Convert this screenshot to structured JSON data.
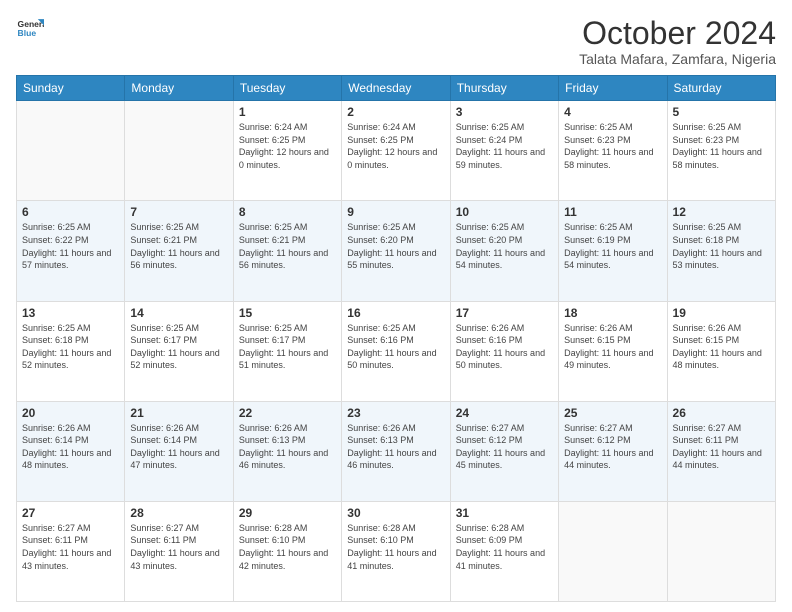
{
  "header": {
    "logo_line1": "General",
    "logo_line2": "Blue",
    "month": "October 2024",
    "location": "Talata Mafara, Zamfara, Nigeria"
  },
  "weekdays": [
    "Sunday",
    "Monday",
    "Tuesday",
    "Wednesday",
    "Thursday",
    "Friday",
    "Saturday"
  ],
  "weeks": [
    [
      {
        "day": "",
        "sunrise": "",
        "sunset": "",
        "daylight": ""
      },
      {
        "day": "",
        "sunrise": "",
        "sunset": "",
        "daylight": ""
      },
      {
        "day": "1",
        "sunrise": "Sunrise: 6:24 AM",
        "sunset": "Sunset: 6:25 PM",
        "daylight": "Daylight: 12 hours and 0 minutes."
      },
      {
        "day": "2",
        "sunrise": "Sunrise: 6:24 AM",
        "sunset": "Sunset: 6:25 PM",
        "daylight": "Daylight: 12 hours and 0 minutes."
      },
      {
        "day": "3",
        "sunrise": "Sunrise: 6:25 AM",
        "sunset": "Sunset: 6:24 PM",
        "daylight": "Daylight: 11 hours and 59 minutes."
      },
      {
        "day": "4",
        "sunrise": "Sunrise: 6:25 AM",
        "sunset": "Sunset: 6:23 PM",
        "daylight": "Daylight: 11 hours and 58 minutes."
      },
      {
        "day": "5",
        "sunrise": "Sunrise: 6:25 AM",
        "sunset": "Sunset: 6:23 PM",
        "daylight": "Daylight: 11 hours and 58 minutes."
      }
    ],
    [
      {
        "day": "6",
        "sunrise": "Sunrise: 6:25 AM",
        "sunset": "Sunset: 6:22 PM",
        "daylight": "Daylight: 11 hours and 57 minutes."
      },
      {
        "day": "7",
        "sunrise": "Sunrise: 6:25 AM",
        "sunset": "Sunset: 6:21 PM",
        "daylight": "Daylight: 11 hours and 56 minutes."
      },
      {
        "day": "8",
        "sunrise": "Sunrise: 6:25 AM",
        "sunset": "Sunset: 6:21 PM",
        "daylight": "Daylight: 11 hours and 56 minutes."
      },
      {
        "day": "9",
        "sunrise": "Sunrise: 6:25 AM",
        "sunset": "Sunset: 6:20 PM",
        "daylight": "Daylight: 11 hours and 55 minutes."
      },
      {
        "day": "10",
        "sunrise": "Sunrise: 6:25 AM",
        "sunset": "Sunset: 6:20 PM",
        "daylight": "Daylight: 11 hours and 54 minutes."
      },
      {
        "day": "11",
        "sunrise": "Sunrise: 6:25 AM",
        "sunset": "Sunset: 6:19 PM",
        "daylight": "Daylight: 11 hours and 54 minutes."
      },
      {
        "day": "12",
        "sunrise": "Sunrise: 6:25 AM",
        "sunset": "Sunset: 6:18 PM",
        "daylight": "Daylight: 11 hours and 53 minutes."
      }
    ],
    [
      {
        "day": "13",
        "sunrise": "Sunrise: 6:25 AM",
        "sunset": "Sunset: 6:18 PM",
        "daylight": "Daylight: 11 hours and 52 minutes."
      },
      {
        "day": "14",
        "sunrise": "Sunrise: 6:25 AM",
        "sunset": "Sunset: 6:17 PM",
        "daylight": "Daylight: 11 hours and 52 minutes."
      },
      {
        "day": "15",
        "sunrise": "Sunrise: 6:25 AM",
        "sunset": "Sunset: 6:17 PM",
        "daylight": "Daylight: 11 hours and 51 minutes."
      },
      {
        "day": "16",
        "sunrise": "Sunrise: 6:25 AM",
        "sunset": "Sunset: 6:16 PM",
        "daylight": "Daylight: 11 hours and 50 minutes."
      },
      {
        "day": "17",
        "sunrise": "Sunrise: 6:26 AM",
        "sunset": "Sunset: 6:16 PM",
        "daylight": "Daylight: 11 hours and 50 minutes."
      },
      {
        "day": "18",
        "sunrise": "Sunrise: 6:26 AM",
        "sunset": "Sunset: 6:15 PM",
        "daylight": "Daylight: 11 hours and 49 minutes."
      },
      {
        "day": "19",
        "sunrise": "Sunrise: 6:26 AM",
        "sunset": "Sunset: 6:15 PM",
        "daylight": "Daylight: 11 hours and 48 minutes."
      }
    ],
    [
      {
        "day": "20",
        "sunrise": "Sunrise: 6:26 AM",
        "sunset": "Sunset: 6:14 PM",
        "daylight": "Daylight: 11 hours and 48 minutes."
      },
      {
        "day": "21",
        "sunrise": "Sunrise: 6:26 AM",
        "sunset": "Sunset: 6:14 PM",
        "daylight": "Daylight: 11 hours and 47 minutes."
      },
      {
        "day": "22",
        "sunrise": "Sunrise: 6:26 AM",
        "sunset": "Sunset: 6:13 PM",
        "daylight": "Daylight: 11 hours and 46 minutes."
      },
      {
        "day": "23",
        "sunrise": "Sunrise: 6:26 AM",
        "sunset": "Sunset: 6:13 PM",
        "daylight": "Daylight: 11 hours and 46 minutes."
      },
      {
        "day": "24",
        "sunrise": "Sunrise: 6:27 AM",
        "sunset": "Sunset: 6:12 PM",
        "daylight": "Daylight: 11 hours and 45 minutes."
      },
      {
        "day": "25",
        "sunrise": "Sunrise: 6:27 AM",
        "sunset": "Sunset: 6:12 PM",
        "daylight": "Daylight: 11 hours and 44 minutes."
      },
      {
        "day": "26",
        "sunrise": "Sunrise: 6:27 AM",
        "sunset": "Sunset: 6:11 PM",
        "daylight": "Daylight: 11 hours and 44 minutes."
      }
    ],
    [
      {
        "day": "27",
        "sunrise": "Sunrise: 6:27 AM",
        "sunset": "Sunset: 6:11 PM",
        "daylight": "Daylight: 11 hours and 43 minutes."
      },
      {
        "day": "28",
        "sunrise": "Sunrise: 6:27 AM",
        "sunset": "Sunset: 6:11 PM",
        "daylight": "Daylight: 11 hours and 43 minutes."
      },
      {
        "day": "29",
        "sunrise": "Sunrise: 6:28 AM",
        "sunset": "Sunset: 6:10 PM",
        "daylight": "Daylight: 11 hours and 42 minutes."
      },
      {
        "day": "30",
        "sunrise": "Sunrise: 6:28 AM",
        "sunset": "Sunset: 6:10 PM",
        "daylight": "Daylight: 11 hours and 41 minutes."
      },
      {
        "day": "31",
        "sunrise": "Sunrise: 6:28 AM",
        "sunset": "Sunset: 6:09 PM",
        "daylight": "Daylight: 11 hours and 41 minutes."
      },
      {
        "day": "",
        "sunrise": "",
        "sunset": "",
        "daylight": ""
      },
      {
        "day": "",
        "sunrise": "",
        "sunset": "",
        "daylight": ""
      }
    ]
  ]
}
